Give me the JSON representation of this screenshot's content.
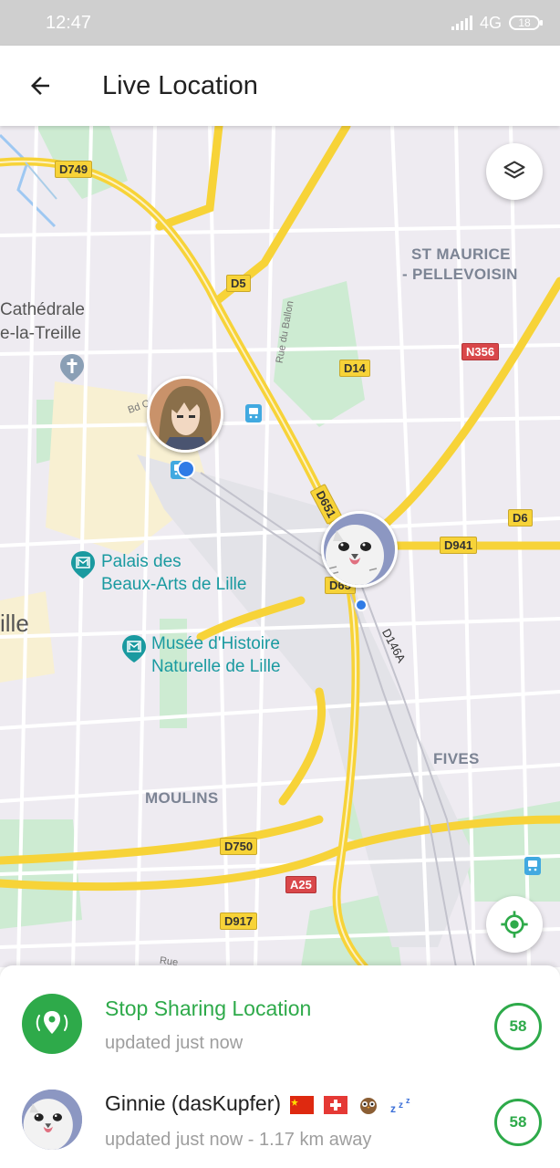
{
  "status_bar": {
    "time": "12:47",
    "network": "4G",
    "battery": "18"
  },
  "app_bar": {
    "title": "Live Location"
  },
  "map": {
    "road_labels": [
      "D749",
      "D5",
      "D14",
      "N356",
      "D6",
      "D941",
      "D651",
      "D65",
      "D146A",
      "D750",
      "A25",
      "D917"
    ],
    "districts": [
      {
        "name": "ST MAURICE"
      },
      {
        "name": "- PELLEVOISIN"
      },
      {
        "name": "FIVES"
      },
      {
        "name": "MOULINS"
      }
    ],
    "places": {
      "cathedral_line1": "Cathédrale",
      "cathedral_line2": "e-la-Treille",
      "lille": "ille"
    },
    "pois": [
      {
        "line1": "Palais des",
        "line2": "Beaux-Arts de Lille"
      },
      {
        "line1": "Musée d'Histoire",
        "line2": "Naturelle de Lille"
      }
    ],
    "streets": {
      "ballon": "Rue du Ballon",
      "bd": "Bd C",
      "rue": "Rue"
    },
    "icons": {
      "layers": "layers-icon",
      "recenter": "my-location-icon"
    }
  },
  "sheet": {
    "stop": {
      "title": "Stop Sharing Location",
      "subtitle": "updated just now",
      "timer": "58"
    },
    "contact": {
      "name": "Ginnie (dasKupfer)",
      "emojis": [
        "china-flag",
        "swiss-flag",
        "owl",
        "zzz"
      ],
      "subtitle": "updated just now - 1.17 km away",
      "timer": "58"
    }
  },
  "colors": {
    "accent": "#2eaa4a",
    "road_major": "#f7d338",
    "map_bg": "#eeebf1",
    "poi": "#1a9aa0"
  }
}
